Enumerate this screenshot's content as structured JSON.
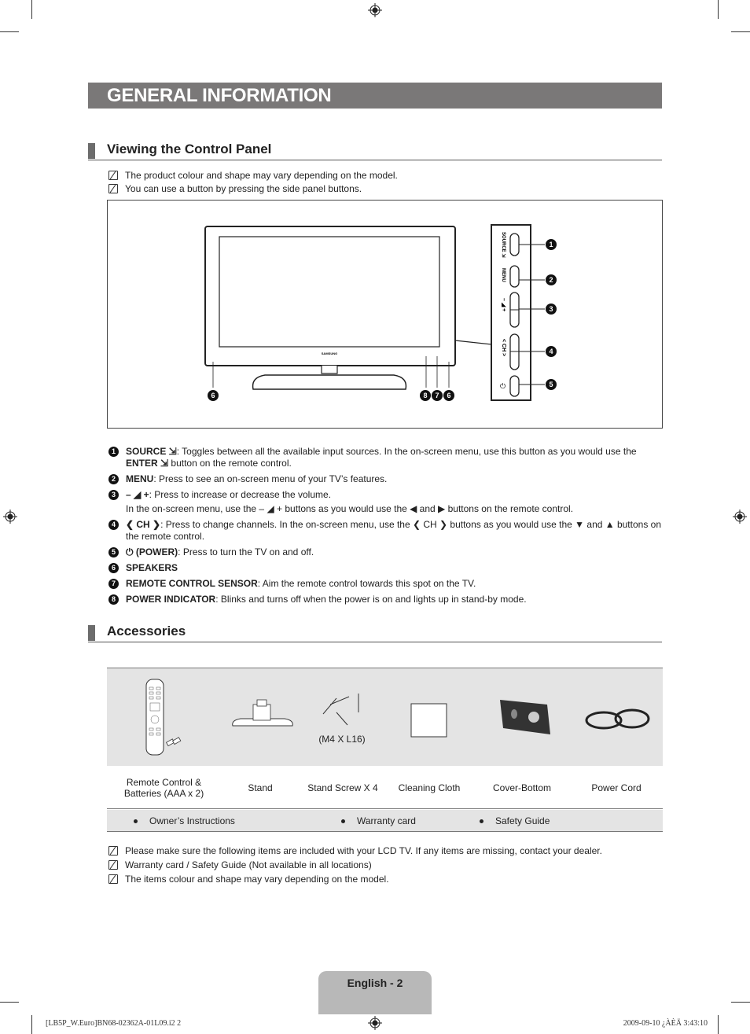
{
  "page_title": "GENERAL INFORMATION",
  "section_control_panel": {
    "heading": "Viewing the Control Panel",
    "notes": [
      "The product colour and shape may vary depending on the model.",
      "You can use a button by pressing the side panel buttons."
    ],
    "diagram": {
      "brand": "SAMSUNG",
      "panel_labels": [
        "SOURCE",
        "MENU",
        "–  +",
        "< CH >",
        "⏻"
      ],
      "callouts": [
        "1",
        "2",
        "3",
        "4",
        "5",
        "6",
        "8",
        "7",
        "6"
      ]
    },
    "items": [
      {
        "num": "1",
        "bold": "SOURCE ⇲",
        "text": ": Toggles between all the available input sources. In the on-screen menu, use this button as you would use the ",
        "bold2": "ENTER ⇲",
        "text2": " button on the remote control."
      },
      {
        "num": "2",
        "bold": "MENU",
        "text": ": Press to see an on-screen menu of your TV’s features."
      },
      {
        "num": "3",
        "bold": "– ◢ +",
        "text": ": Press to increase or decrease the volume.",
        "line2": "In the on-screen menu, use the – ◢ + buttons as you would use the ◀ and ▶ buttons on the remote control."
      },
      {
        "num": "4",
        "bold": "❮ CH ❯",
        "text": ": Press to change channels. In the on-screen menu, use the ❮ CH ❯ buttons as you would use the ▼ and ▲ buttons on the remote control."
      },
      {
        "num": "5",
        "bold": "⏻ (POWER)",
        "text": ": Press to turn the TV on and off."
      },
      {
        "num": "6",
        "bold": "SPEAKERS",
        "text": ""
      },
      {
        "num": "7",
        "bold": "REMOTE CONTROL SENSOR",
        "text": ": Aim the remote control towards this spot on the TV."
      },
      {
        "num": "8",
        "bold": "POWER INDICATOR",
        "text": ": Blinks and turns off when the power is on and lights up in stand-by mode."
      }
    ]
  },
  "section_accessories": {
    "heading": "Accessories",
    "screw_spec": "(M4 X L16)",
    "items": [
      "Remote Control & Batteries (AAA x 2)",
      "Stand",
      "Stand Screw X 4",
      "Cleaning Cloth",
      "Cover-Bottom",
      "Power Cord"
    ],
    "documents": [
      "Owner’s Instructions",
      "Warranty card",
      "Safety Guide"
    ],
    "notes": [
      "Please make sure the following items are included with your LCD TV. If any items are missing, contact your dealer.",
      "Warranty card / Safety Guide (Not available in all locations)",
      "The items colour and shape may vary depending on the model."
    ]
  },
  "footer": {
    "page_label": "English - 2",
    "print_left": "[LB5P_W.Euro]BN68-02362A-01L09.i2   2",
    "print_right": "2009-09-10   ¿ÀÈÄ 3:43:10"
  }
}
